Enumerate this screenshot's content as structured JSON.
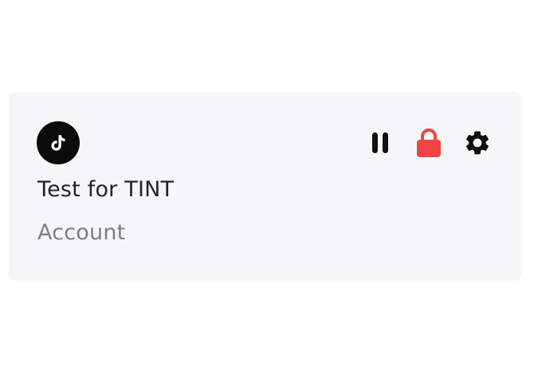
{
  "card": {
    "title": "Test for TINT",
    "subtitle": "Account",
    "avatar_icon": "tiktok-logo-icon",
    "actions": [
      {
        "name": "pause-button",
        "icon": "pause-icon",
        "color": "#111111"
      },
      {
        "name": "lock-button",
        "icon": "lock-icon",
        "color": "#f04545"
      },
      {
        "name": "settings-button",
        "icon": "gear-icon",
        "color": "#111111"
      }
    ]
  },
  "colors": {
    "card_background": "#f5f6f8",
    "title_text": "#1f2329",
    "subtitle_text": "#7a7f88",
    "lock_red": "#f04545"
  }
}
